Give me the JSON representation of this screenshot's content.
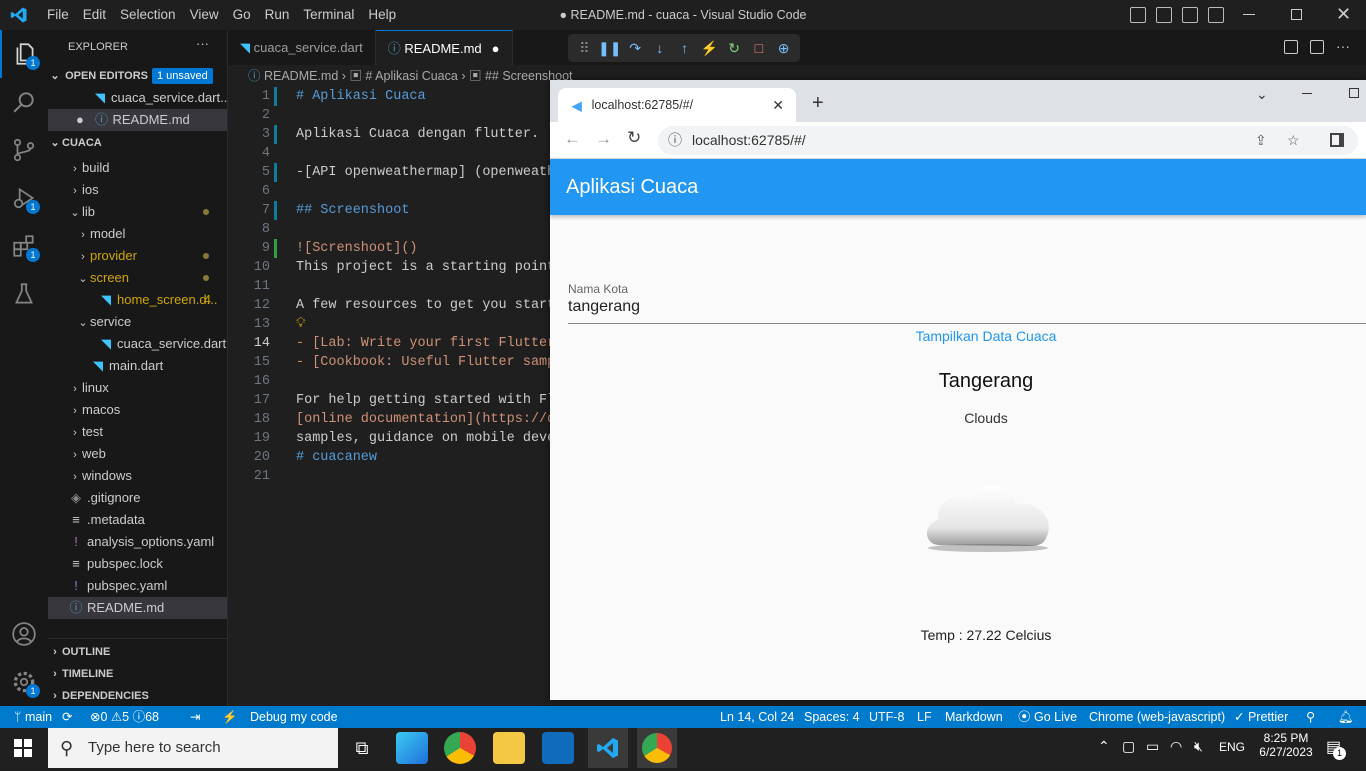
{
  "window": {
    "title": "● README.md - cuaca - Visual Studio Code",
    "menu": [
      "File",
      "Edit",
      "Selection",
      "View",
      "Go",
      "Run",
      "Terminal",
      "Help"
    ]
  },
  "activity": {
    "badges": {
      "explorer": "1",
      "debug": "1",
      "extensions": "1"
    }
  },
  "explorer": {
    "header": "EXPLORER",
    "more": "···",
    "open_editors_label": "OPEN EDITORS",
    "unsaved_badge": "1 unsaved",
    "open_editors": [
      "cuaca_service.dart...",
      "README.md"
    ],
    "project": "CUACA",
    "tree": [
      {
        "label": "build",
        "icon": "chevron-right"
      },
      {
        "label": "ios",
        "icon": "chevron-right"
      },
      {
        "label": "lib",
        "icon": "chevron-down"
      },
      {
        "label": "model",
        "icon": "chevron-right"
      },
      {
        "label": "provider",
        "icon": "chevron-right"
      },
      {
        "label": "screen",
        "icon": "chevron-down"
      },
      {
        "label": "home_screen.d...",
        "icon": "dart",
        "problems": "4"
      },
      {
        "label": "service",
        "icon": "chevron-down"
      },
      {
        "label": "cuaca_service.dart",
        "icon": "dart"
      },
      {
        "label": "main.dart",
        "icon": "dart"
      },
      {
        "label": "linux",
        "icon": "chevron-right"
      },
      {
        "label": "macos",
        "icon": "chevron-right"
      },
      {
        "label": "test",
        "icon": "chevron-right"
      },
      {
        "label": "web",
        "icon": "chevron-right"
      },
      {
        "label": "windows",
        "icon": "chevron-right"
      },
      {
        "label": ".gitignore",
        "icon": "git"
      },
      {
        "label": ".metadata",
        "icon": "lines"
      },
      {
        "label": "analysis_options.yaml",
        "icon": "yaml"
      },
      {
        "label": "pubspec.lock",
        "icon": "lines"
      },
      {
        "label": "pubspec.yaml",
        "icon": "yaml"
      },
      {
        "label": "README.md",
        "icon": "info"
      }
    ],
    "outline": "OUTLINE",
    "timeline": "TIMELINE",
    "dependencies": "DEPENDENCIES"
  },
  "editor": {
    "tabs": [
      "cuaca_service.dart",
      "README.md"
    ],
    "breadcrumb": [
      "README.md",
      "# Aplikasi Cuaca",
      "## Screenshoot"
    ],
    "lines": [
      {
        "n": "1",
        "t": "# Aplikasi Cuaca"
      },
      {
        "n": "2",
        "t": ""
      },
      {
        "n": "3",
        "t": "Aplikasi Cuaca dengan flutter."
      },
      {
        "n": "4",
        "t": ""
      },
      {
        "n": "5",
        "t": "-[API openweathermap] (openweathe"
      },
      {
        "n": "6",
        "t": ""
      },
      {
        "n": "7",
        "t": "## Screenshoot"
      },
      {
        "n": "8",
        "t": ""
      },
      {
        "n": "9",
        "t": "![Screnshoot]()"
      },
      {
        "n": "10",
        "t": "This project is a starting point"
      },
      {
        "n": "11",
        "t": ""
      },
      {
        "n": "12",
        "t": "A few resources to get you starte"
      },
      {
        "n": "13",
        "t": ""
      },
      {
        "n": "14",
        "t": "- [Lab: Write your first Flutter"
      },
      {
        "n": "15",
        "t": "- [Cookbook: Useful Flutter sampl"
      },
      {
        "n": "16",
        "t": ""
      },
      {
        "n": "17",
        "t": "For help getting started with Flu"
      },
      {
        "n": "18",
        "t": "[online documentation](https://do"
      },
      {
        "n": "19",
        "t": "samples, guidance on mobile devel"
      },
      {
        "n": "20",
        "t": "# cuacanew"
      },
      {
        "n": "21",
        "t": ""
      }
    ]
  },
  "browser": {
    "tab_title": "localhost:62785/#/",
    "url": "localhost:62785/#/",
    "app_title": "Aplikasi Cuaca",
    "field_label": "Nama Kota",
    "field_value": "tangerang",
    "button": "Tampilkan Data Cuaca",
    "city": "Tangerang",
    "condition": "Clouds",
    "temp": "Temp : 27.22 Celcius"
  },
  "status": {
    "branch": "main",
    "errors": "0",
    "warnings": "5",
    "infos": "68",
    "debug": "Debug my code",
    "position": "Ln 14, Col 24",
    "spaces": "Spaces: 4",
    "encoding": "UTF-8",
    "eol": "LF",
    "language": "Markdown",
    "golive": "Go Live",
    "chrome": "Chrome (web-javascript)",
    "prettier": "Prettier"
  },
  "taskbar": {
    "search": "Type here to search",
    "lang": "ENG",
    "time": "8:25 PM",
    "date": "6/27/2023",
    "notif": "1"
  },
  "colors": {
    "accent": "#0078d4",
    "status": "#007acc",
    "appbar": "#2196f3"
  }
}
